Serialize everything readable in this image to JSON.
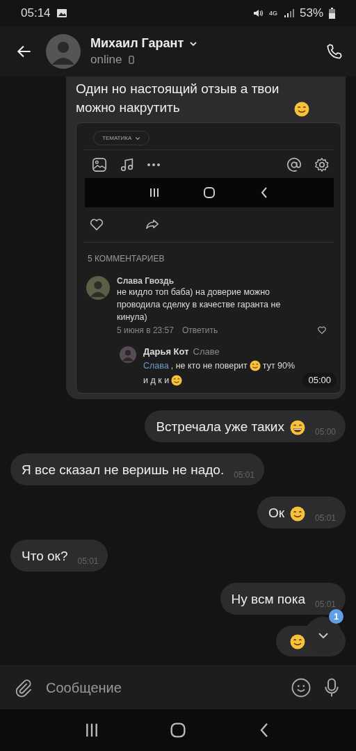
{
  "status_bar": {
    "time": "05:14",
    "network": "4G",
    "battery": "53%"
  },
  "header": {
    "name": "Михаил Гарант",
    "status": "online"
  },
  "shared_post": {
    "text": "Один но настоящий отзыв а твои можно накрутить",
    "emoji": {
      "kind": "smile"
    },
    "time": "05:00",
    "screenshot": {
      "chip": "ТЕМАТИКА",
      "comments_count": "5 КОММЕНТАРИЕВ",
      "comment": {
        "author": "Слава Гвоздь",
        "text": "не кидло топ баба) на доверие можно проводила сделку в качестве гаранта не кинула)",
        "date": "5 июня в 23:57",
        "reply_link": "Ответить"
      },
      "reply": {
        "author": "Дарья Кот",
        "to": "Славе",
        "mention": "Слава",
        "text": ", не кто не поверит",
        "text_2": "тут 90%",
        "text_3": "и д к и"
      }
    }
  },
  "messages": [
    {
      "kind": "out",
      "text": "Встречала уже таких",
      "emoji": {
        "kind": "grin"
      },
      "time": "05:00"
    },
    {
      "kind": "in",
      "text": "Я все сказал не веришь не надо.",
      "time": "05:01"
    },
    {
      "kind": "out",
      "text": "Ок",
      "emoji": {
        "kind": "smile"
      },
      "time": "05:01"
    },
    {
      "kind": "in",
      "text": "Что ок?",
      "time": "05:01"
    },
    {
      "kind": "out",
      "text": "Ну всм пока",
      "time": "05:01"
    },
    {
      "kind": "out",
      "emoji": {
        "kind": "smile"
      }
    }
  ],
  "scroll_button": {
    "badge": "1"
  },
  "composer": {
    "placeholder": "Сообщение"
  }
}
